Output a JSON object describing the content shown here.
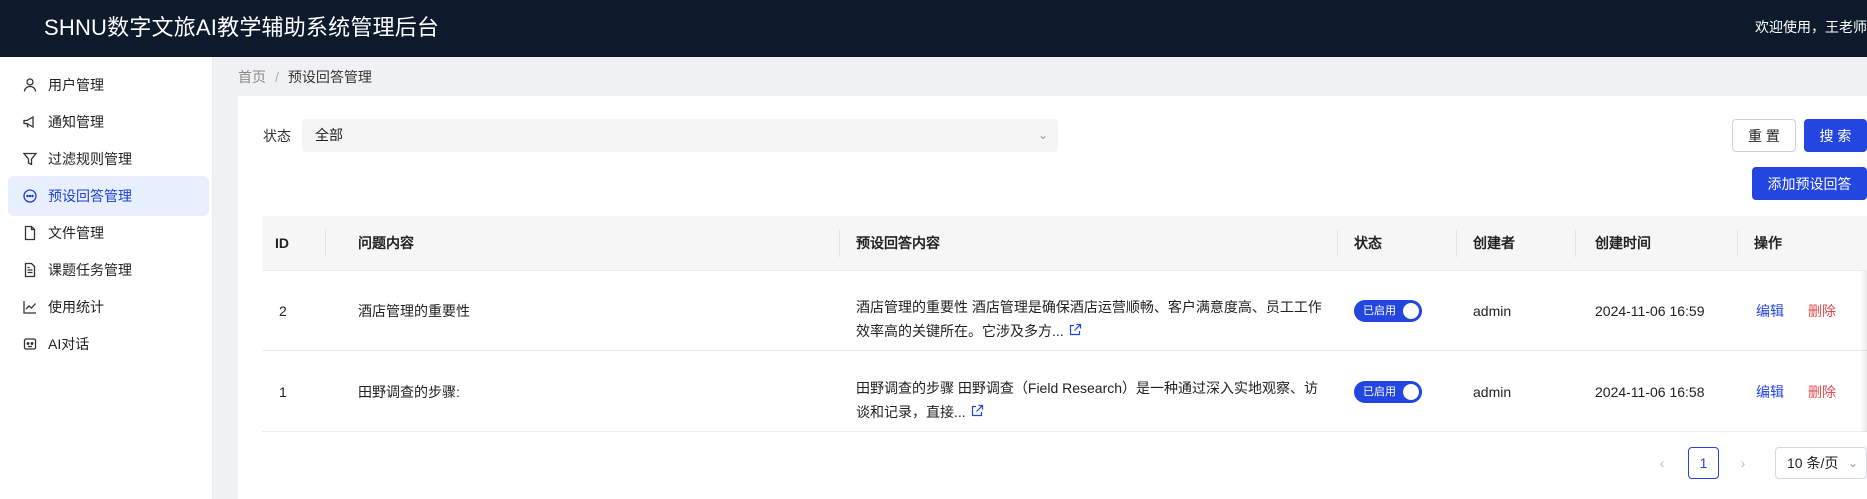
{
  "header": {
    "title": "SHNU数字文旅AI教学辅助系统管理后台",
    "welcome": "欢迎使用，王老师"
  },
  "sidebar": {
    "items": [
      {
        "label": "用户管理",
        "icon": "user-icon"
      },
      {
        "label": "通知管理",
        "icon": "megaphone-icon"
      },
      {
        "label": "过滤规则管理",
        "icon": "filter-icon"
      },
      {
        "label": "预设回答管理",
        "icon": "chat-icon",
        "active": true
      },
      {
        "label": "文件管理",
        "icon": "file-icon"
      },
      {
        "label": "课题任务管理",
        "icon": "document-icon"
      },
      {
        "label": "使用统计",
        "icon": "chart-line-icon"
      },
      {
        "label": "AI对话",
        "icon": "robot-icon"
      }
    ]
  },
  "breadcrumb": {
    "home": "首页",
    "separator": "/",
    "current": "预设回答管理"
  },
  "filter": {
    "status_label": "状态",
    "status_value": "全部"
  },
  "actions": {
    "reset": "重 置",
    "search": "搜 索",
    "add": "添加预设回答"
  },
  "table": {
    "headers": {
      "id": "ID",
      "question": "问题内容",
      "answer": "预设回答内容",
      "status": "状态",
      "creator": "创建者",
      "created_at": "创建时间",
      "ops": "操作"
    },
    "rows": [
      {
        "id": "2",
        "question": "酒店管理的重要性",
        "answer": "酒店管理的重要性 酒店管理是确保酒店运营顺畅、客户满意度高、员工工作效率高的关键所在。它涉及多方...",
        "status": "已启用",
        "enabled": true,
        "creator": "admin",
        "created_at": "2024-11-06 16:59",
        "edit": "编辑",
        "delete": "删除"
      },
      {
        "id": "1",
        "question": "田野调查的步骤:",
        "answer": "田野调查的步骤 田野调查（Field Research）是一种通过深入实地观察、访谈和记录，直接...",
        "status": "已启用",
        "enabled": true,
        "creator": "admin",
        "created_at": "2024-11-06 16:58",
        "edit": "编辑",
        "delete": "删除"
      }
    ]
  },
  "pagination": {
    "current_page": "1",
    "page_size": "10 条/页"
  },
  "colors": {
    "header_bg": "#0c1a2b",
    "primary": "#2346e0",
    "danger": "#e5484d",
    "active_menu_bg": "#e8efff"
  }
}
